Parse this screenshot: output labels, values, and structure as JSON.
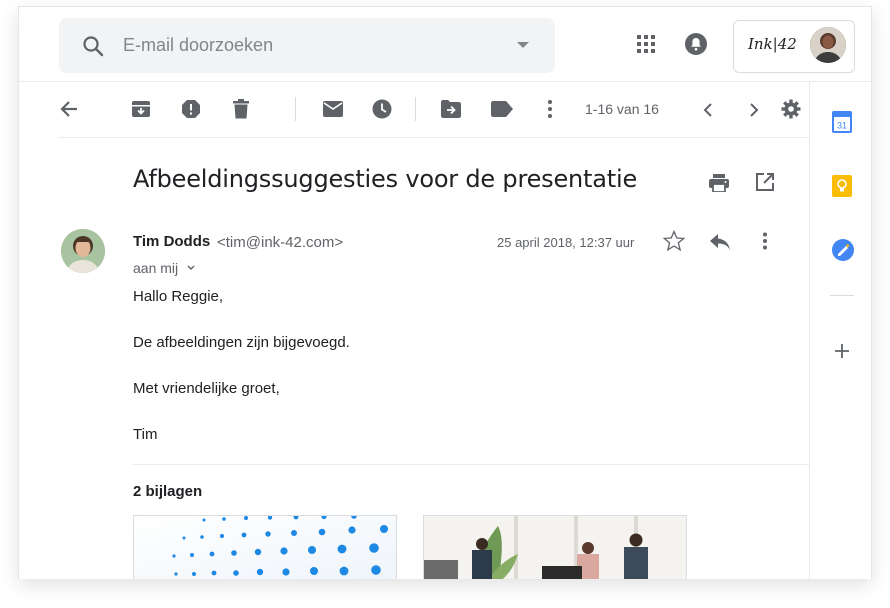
{
  "search": {
    "placeholder": "E-mail doorzoeken"
  },
  "account": {
    "logo_text": "Ink|42"
  },
  "toolbar": {
    "pager": "1-16 van 16"
  },
  "message": {
    "subject": "Afbeeldingssuggesties voor de presentatie",
    "sender_name": "Tim Dodds",
    "sender_email": "<tim@ink-42.com>",
    "recipient": "aan mij",
    "datetime": "25 april 2018, 12:37 uur",
    "body": [
      "Hallo Reggie,",
      "De afbeeldingen zijn bijgevoegd.",
      "Met vriendelijke groet,",
      "Tim"
    ]
  },
  "attachments": {
    "title": "2 bijlagen"
  },
  "colors": {
    "accent_blue": "#1a73e8",
    "calendar_blue": "#4285f4",
    "keep_yellow": "#fbbc04",
    "icon_grey": "#5f6368"
  },
  "icons": [
    "search-icon",
    "apps-grid-icon",
    "notifications-icon",
    "back-arrow-icon",
    "archive-icon",
    "report-spam-icon",
    "delete-icon",
    "mark-unread-icon",
    "snooze-icon",
    "move-to-icon",
    "label-icon",
    "more-vert-icon",
    "chevron-left-icon",
    "chevron-right-icon",
    "settings-icon",
    "print-icon",
    "open-new-window-icon",
    "star-icon",
    "reply-icon",
    "calendar-icon",
    "keep-icon",
    "tasks-icon",
    "add-icon"
  ]
}
